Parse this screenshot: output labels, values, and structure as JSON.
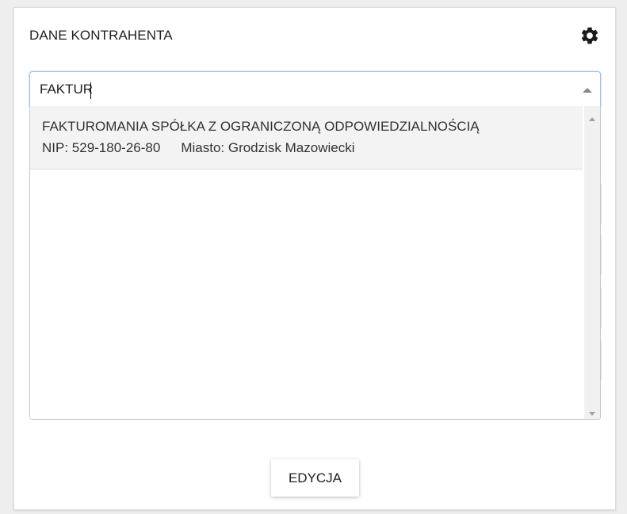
{
  "panel": {
    "title": "DANE KONTRAHENTA",
    "settings_icon": "gear-icon"
  },
  "search": {
    "value": "FAKTUR",
    "arrow_icon": "triangle-up-icon"
  },
  "results": [
    {
      "name": "FAKTUROMANIA SPÓŁKA Z OGRANICZONĄ ODPOWIEDZIALNOŚCIĄ",
      "nip": "NIP: 529-180-26-80",
      "city": "Miasto: Grodzisk Mazowiecki"
    }
  ],
  "footer": {
    "edit_label": "EDYCJA"
  }
}
